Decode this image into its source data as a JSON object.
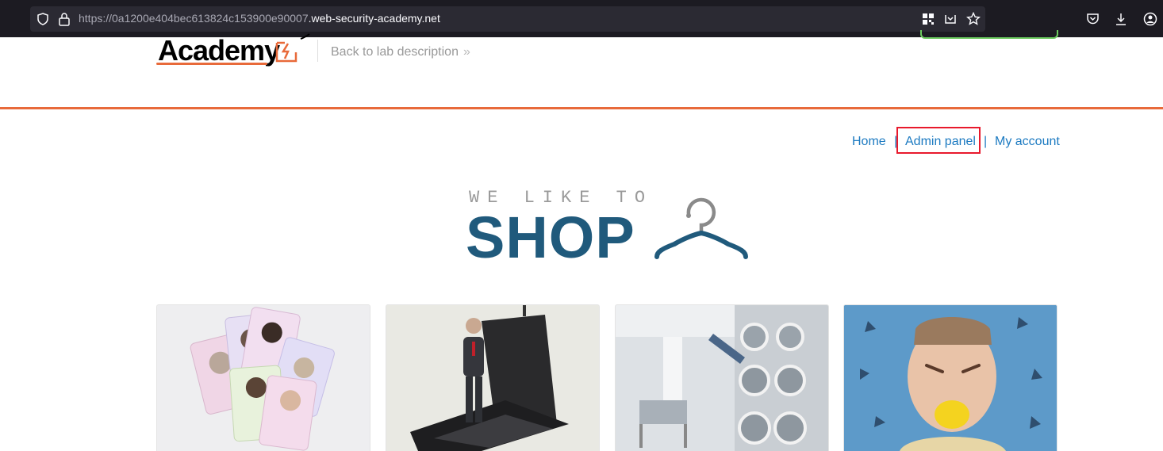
{
  "browser": {
    "url_prefix": "https://0a1200e404bec613824c153900e90007",
    "url_domain": ".web-security-academy.net"
  },
  "lab_header": {
    "logo_text": "Academy",
    "back_link": "Back to lab description",
    "back_chevron": "»"
  },
  "nav": {
    "home": "Home",
    "separator": "|",
    "admin_panel": "Admin panel",
    "my_account": "My account"
  },
  "banner": {
    "tagline": "WE LIKE TO",
    "title": "SHOP"
  },
  "products": [
    {
      "image": "politician-trading-cards"
    },
    {
      "image": "man-on-flip-phone"
    },
    {
      "image": "laundromat-washing-machine"
    },
    {
      "image": "man-biting-lemon"
    }
  ],
  "colors": {
    "accent_orange": "#e86a3a",
    "link_blue": "#1c7ac1",
    "shop_blue": "#205a7c",
    "highlight_red": "#e8192c"
  }
}
